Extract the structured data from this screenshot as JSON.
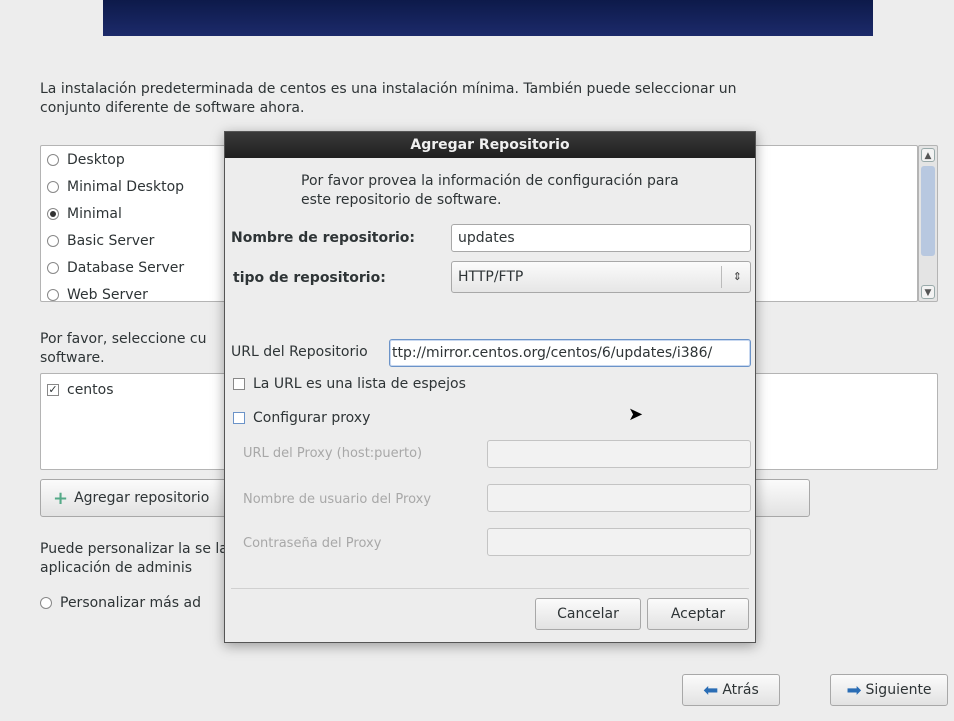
{
  "intro_text": "La instalación predeterminada de centos es una instalación mínima. También puede seleccionar un conjunto diferente de software ahora.",
  "software_sets": [
    {
      "label": "Desktop",
      "selected": false
    },
    {
      "label": "Minimal Desktop",
      "selected": false
    },
    {
      "label": "Minimal",
      "selected": true
    },
    {
      "label": "Basic Server",
      "selected": false
    },
    {
      "label": "Database Server",
      "selected": false
    },
    {
      "label": "Web Server",
      "selected": false
    }
  ],
  "repo_prompt": "Por favor, seleccione cu software.",
  "repositories": [
    {
      "label": "centos",
      "checked": true
    }
  ],
  "add_repo_label": "Agregar repositorio",
  "customize_text": "Puede personalizar la se la aplicación de adminis",
  "customize_option": "Personalizar más ad",
  "nav": {
    "back_label": "Atrás",
    "next_label": "Siguiente"
  },
  "dialog": {
    "title": "Agregar Repositorio",
    "message": "Por favor provea la información de configuración para este repositorio de software.",
    "name_label": "Nombre de repositorio:",
    "name_value": "updates",
    "type_label": "tipo de repositorio:",
    "type_value": "HTTP/FTP",
    "url_label": "URL del Repositorio",
    "url_value": "ttp://mirror.centos.org/centos/6/updates/i386/",
    "mirror_list_label": "La URL es una lista de espejos",
    "mirror_list_checked": false,
    "proxy_label": "Configurar proxy",
    "proxy_checked": false,
    "proxy_url_label": "URL del Proxy (host:puerto)",
    "proxy_user_label": "Nombre de usuario del Proxy",
    "proxy_pass_label": "Contraseña del Proxy",
    "cancel_label": "Cancelar",
    "accept_label": "Aceptar"
  },
  "colors": {
    "banner": "#1c2a6a",
    "dialog_title_bg": "#2a2a2a",
    "arrow_icon": "#2a6db5"
  }
}
